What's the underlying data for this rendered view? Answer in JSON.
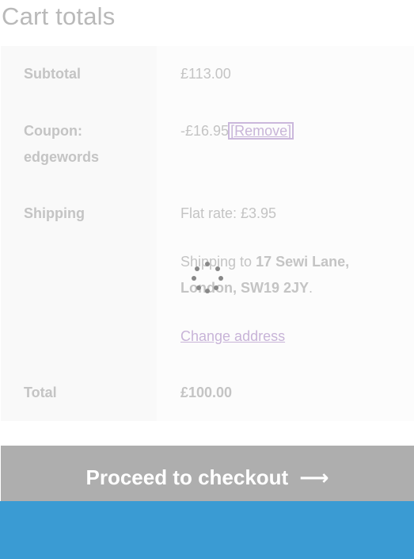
{
  "cart_totals": {
    "heading": "Cart totals",
    "subtotal": {
      "label": "Subtotal",
      "value": "£113.00"
    },
    "coupon": {
      "label_line1": "Coupon:",
      "label_line2": "edgewords",
      "value": "-£16.95",
      "remove_label": "[Remove]"
    },
    "shipping": {
      "label": "Shipping",
      "method": "Flat rate: £3.95",
      "dest_prefix": "Shipping to ",
      "dest_address": "17 Sewi Lane, London, SW19 2JY",
      "dest_suffix": ".",
      "change_address": "Change address"
    },
    "total": {
      "label": "Total",
      "value": "£100.00"
    },
    "checkout_button": {
      "label": "Proceed to checkout",
      "arrow": "⟶"
    }
  },
  "colors": {
    "checkout_button_bg": "#aeaeae",
    "footer_bar": "#3a9bd3",
    "link": "#c8b4d8"
  }
}
